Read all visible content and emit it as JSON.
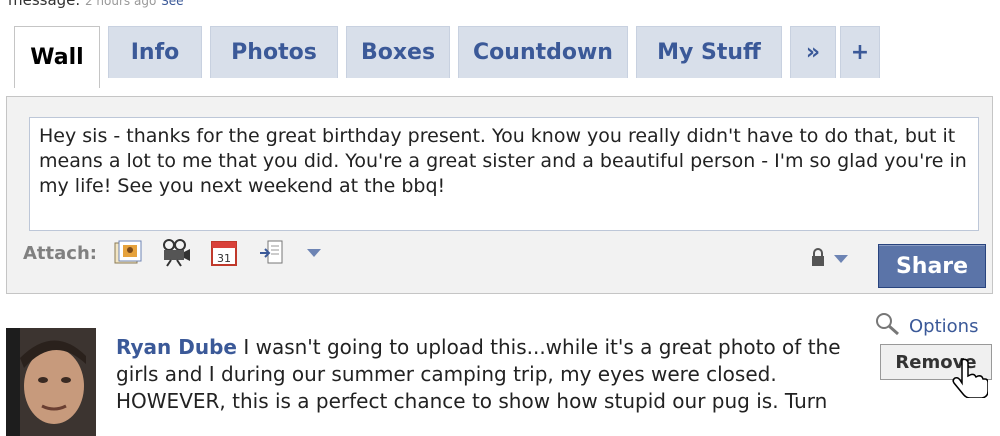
{
  "top_partial": {
    "text": "message.",
    "time": "2 hours ago",
    "link": "See"
  },
  "tabs": [
    {
      "label": "Wall",
      "active": true
    },
    {
      "label": "Info"
    },
    {
      "label": "Photos"
    },
    {
      "label": "Boxes"
    },
    {
      "label": "Countdown"
    },
    {
      "label": "My Stuff"
    },
    {
      "label": "»"
    },
    {
      "label": "+"
    }
  ],
  "composer": {
    "text": "Hey sis - thanks for the great birthday present. You know you really didn't have to do that, but it means a lot to me that you did. You're a great sister and a beautiful person - I'm so glad you're in my life! See you next weekend at the bbq!",
    "attach_label": "Attach:",
    "attach_icons": [
      "photo-icon",
      "video-camera-icon",
      "calendar-icon",
      "link-share-icon"
    ],
    "calendar_number": "31",
    "share_label": "Share",
    "privacy_icon": "lock-icon"
  },
  "post": {
    "author": "Ryan Dube",
    "text": "I wasn't going to upload this...while it's a great photo of the girls and I during our summer camping trip, my eyes were closed. HOWEVER, this is a perfect chance to show how stupid our pug is. Turn",
    "options_label": "Options",
    "remove_label": "Remove"
  },
  "colors": {
    "brand": "#3b5998",
    "tab_bg": "#d8dfea",
    "share_bg": "#5b74a8"
  }
}
